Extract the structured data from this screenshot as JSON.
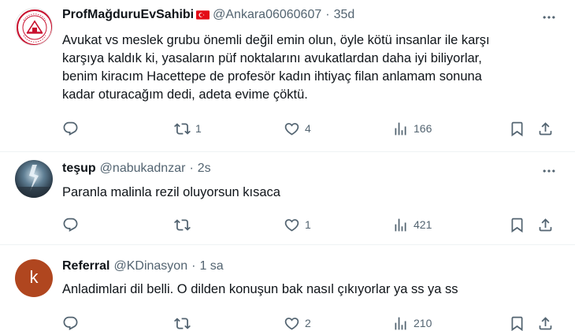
{
  "tweets": [
    {
      "name": "ProfMağduruEvSahibi",
      "handle": "@Ankara06060607",
      "sep": "·",
      "time": "35d",
      "text_lines": [
        "Avukat vs meslek grubu önemli değil emin olun, öyle kötü insanlar ile karşı",
        "karşıya kaldık ki, yasaların püf noktalarını avukatlardan daha iyi biliyorlar,",
        "benim kiracım Hacettepe de profesör kadın ihtiyaç filan anlamam sonuna",
        "kadar oturacağım dedi, adeta evime çöktü."
      ],
      "replies": "",
      "retweets": "1",
      "likes": "4",
      "views": "166",
      "avatar_text": [
        "EV SAHİPLERİ",
        "TÜRKİYE",
        "ADALET"
      ]
    },
    {
      "name": "teşup",
      "handle": "@nabukadnzar",
      "sep": "·",
      "time": "2s",
      "text_lines": [
        "Paranla malinla rezil oluyorsun kısaca"
      ],
      "replies": "",
      "retweets": "",
      "likes": "1",
      "views": "421"
    },
    {
      "name": "Referral",
      "handle": "@KDinasyon",
      "sep": "·",
      "time": "1 sa",
      "text_lines": [
        "Anladimlari dil belli. O dilden konuşun bak nasıl çıkıyorlar ya ss ya ss"
      ],
      "replies": "",
      "retweets": "",
      "likes": "2",
      "views": "210",
      "avatar_letter": "k"
    }
  ],
  "colors": {
    "text": "#0f1419",
    "secondary": "#536471",
    "divider": "#eff3f4",
    "k_avatar": "#b0461f",
    "flag_red": "#e30a17"
  },
  "icons": [
    "more-icon",
    "reply-icon",
    "retweet-icon",
    "like-icon",
    "views-icon",
    "bookmark-icon",
    "share-icon",
    "turkish-flag-icon"
  ]
}
